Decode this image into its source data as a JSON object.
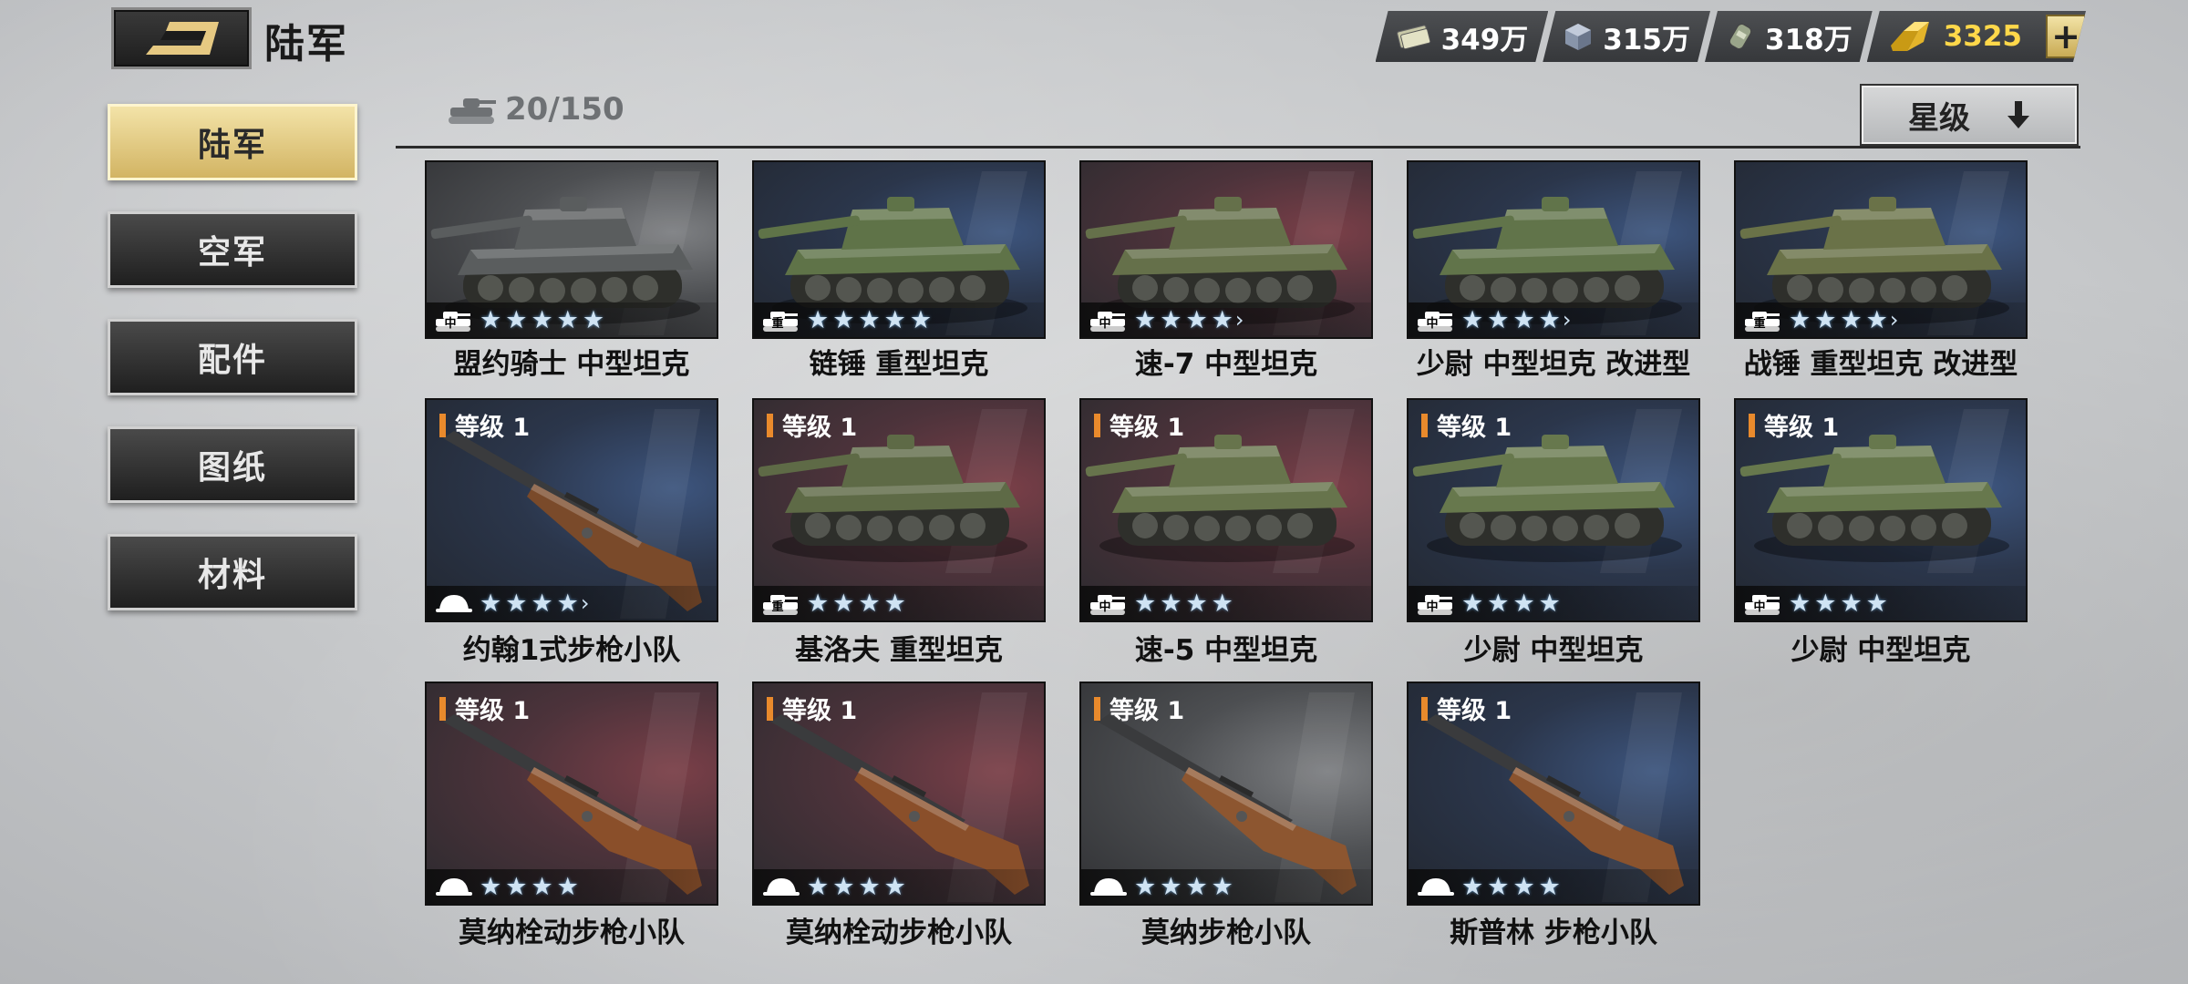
{
  "header": {
    "title": "陆军",
    "back_icon": "back-arrow-icon"
  },
  "currencies": [
    {
      "icon": "cash-icon",
      "value": "349万"
    },
    {
      "icon": "steel-icon",
      "value": "315万"
    },
    {
      "icon": "fuel-icon",
      "value": "318万"
    },
    {
      "icon": "gold-icon",
      "value": "3325"
    }
  ],
  "add_label": "+",
  "sidebar": {
    "items": [
      {
        "label": "陆军",
        "active": true
      },
      {
        "label": "空军",
        "active": false
      },
      {
        "label": "配件",
        "active": false
      },
      {
        "label": "图纸",
        "active": false
      },
      {
        "label": "材料",
        "active": false
      }
    ]
  },
  "capacity": {
    "icon": "tank-icon",
    "text": "20/150"
  },
  "sort": {
    "label": "星级",
    "icon": "arrow-down-icon"
  },
  "units": [
    {
      "name": "盟约骑士 中型坦克",
      "kind": "tank",
      "role": "中",
      "stars": 5,
      "more": false,
      "level": "",
      "bg": "grey",
      "hue": "#5a5d5e"
    },
    {
      "name": "链锤 重型坦克",
      "kind": "tank",
      "role": "重",
      "stars": 5,
      "more": false,
      "level": "",
      "bg": "blue",
      "hue": "#5f7348"
    },
    {
      "name": "速-7 中型坦克",
      "kind": "tank",
      "role": "中",
      "stars": 4,
      "more": true,
      "level": "",
      "bg": "red",
      "hue": "#65704a"
    },
    {
      "name": "少尉 中型坦克 改进型",
      "kind": "tank",
      "role": "中",
      "stars": 4,
      "more": true,
      "level": "",
      "bg": "blue",
      "hue": "#61744a"
    },
    {
      "name": "战锤 重型坦克 改进型",
      "kind": "tank",
      "role": "重",
      "stars": 4,
      "more": true,
      "level": "",
      "bg": "blue",
      "hue": "#6a7248"
    },
    {
      "name": "约翰1式步枪小队",
      "kind": "rifle",
      "role": "兵",
      "stars": 4,
      "more": true,
      "level": "等级 1",
      "bg": "blue",
      "hue": "#7a4a2a"
    },
    {
      "name": "基洛夫 重型坦克",
      "kind": "tank",
      "role": "重",
      "stars": 4,
      "more": false,
      "level": "等级 1",
      "bg": "red",
      "hue": "#5e6a46"
    },
    {
      "name": "速-5 中型坦克",
      "kind": "tank",
      "role": "中",
      "stars": 4,
      "more": false,
      "level": "等级 1",
      "bg": "red",
      "hue": "#67744c"
    },
    {
      "name": "少尉 中型坦克",
      "kind": "tank",
      "role": "中",
      "stars": 4,
      "more": false,
      "level": "等级 1",
      "bg": "blue",
      "hue": "#67784d"
    },
    {
      "name": "少尉 中型坦克",
      "kind": "tank",
      "role": "中",
      "stars": 4,
      "more": false,
      "level": "等级 1",
      "bg": "blue",
      "hue": "#67784d"
    },
    {
      "name": "莫纳栓动步枪小队",
      "kind": "rifle",
      "role": "兵",
      "stars": 4,
      "more": false,
      "level": "等级 1",
      "bg": "red",
      "hue": "#8a4f2a"
    },
    {
      "name": "莫纳栓动步枪小队",
      "kind": "rifle",
      "role": "兵",
      "stars": 4,
      "more": false,
      "level": "等级 1",
      "bg": "red",
      "hue": "#8a4f2a"
    },
    {
      "name": "莫纳步枪小队",
      "kind": "rifle",
      "role": "兵",
      "stars": 4,
      "more": false,
      "level": "等级 1",
      "bg": "grey",
      "hue": "#8d5630"
    },
    {
      "name": "斯普林 步枪小队",
      "kind": "rifle",
      "role": "兵",
      "stars": 4,
      "more": false,
      "level": "等级 1",
      "bg": "blue",
      "hue": "#8a532e"
    }
  ]
}
